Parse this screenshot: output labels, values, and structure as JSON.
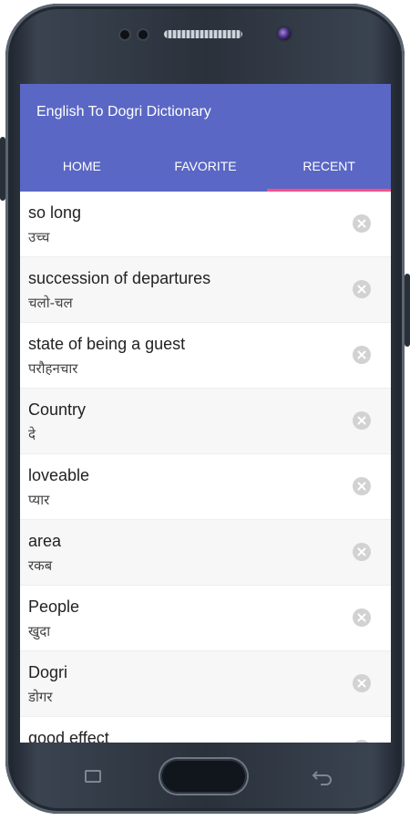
{
  "app": {
    "title": "English To Dogri Dictionary"
  },
  "tabs": [
    {
      "label": "HOME"
    },
    {
      "label": "FAVORITE"
    },
    {
      "label": "RECENT"
    }
  ],
  "active_tab": "RECENT",
  "recent": [
    {
      "term": "so long",
      "translation": "उच्च"
    },
    {
      "term": "succession of departures",
      "translation": "चलो-चल"
    },
    {
      "term": "state of being a guest",
      "translation": "परौहनचार"
    },
    {
      "term": "Country",
      "translation": "दे"
    },
    {
      "term": "loveable",
      "translation": "प्यार"
    },
    {
      "term": "area",
      "translation": "रकब"
    },
    {
      "term": "People",
      "translation": "खुदा"
    },
    {
      "term": "Dogri",
      "translation": "डोगर"
    },
    {
      "term": "good effect",
      "translation": ""
    }
  ],
  "colors": {
    "app_bar": "#5a67c4",
    "tab_indicator": "#ff4f86",
    "remove_icon": "#d2d2d2"
  }
}
